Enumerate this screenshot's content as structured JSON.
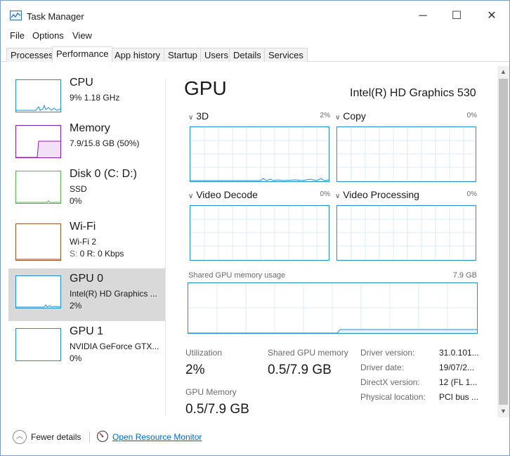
{
  "window": {
    "title": "Task Manager",
    "controls": {
      "minimize": "─",
      "maximize": "☐",
      "close": "✕"
    }
  },
  "menu": [
    "File",
    "Options",
    "View"
  ],
  "tabs": [
    "Processes",
    "Performance",
    "App history",
    "Startup",
    "Users",
    "Details",
    "Services"
  ],
  "active_tab": "Performance",
  "sidebar": {
    "items": [
      {
        "title": "CPU",
        "sub1": "9%  1.18 GHz",
        "sub2": "",
        "color": "#1f8fce"
      },
      {
        "title": "Memory",
        "sub1": "7.9/15.8 GB (50%)",
        "sub2": "",
        "color": "#8b19b3"
      },
      {
        "title": "Disk 0 (C: D:)",
        "sub1": "SSD",
        "sub2": "0%",
        "color": "#4db84d"
      },
      {
        "title": "Wi-Fi",
        "sub1": "Wi-Fi 2",
        "sub2_prefix": "S: ",
        "sub2": "0  R: 0 Kbps",
        "color": "#a0522d"
      },
      {
        "title": "GPU 0",
        "sub1": "Intel(R) HD Graphics ...",
        "sub2": "2%",
        "color": "#1f8fce"
      },
      {
        "title": "GPU 1",
        "sub1": "NVIDIA GeForce GTX...",
        "sub2": "0%",
        "color": "#1f8fce"
      }
    ],
    "selected": "GPU 0"
  },
  "main": {
    "title": "GPU",
    "device_name": "Intel(R) HD Graphics 530",
    "graphs": [
      {
        "label": "3D",
        "percent": "2%",
        "chevron": "∨"
      },
      {
        "label": "Copy",
        "percent": "0%",
        "chevron": "∨"
      },
      {
        "label": "Video Decode",
        "percent": "0%",
        "chevron": "∨"
      },
      {
        "label": "Video Processing",
        "percent": "0%",
        "chevron": "∨"
      }
    ],
    "shared_memory": {
      "label": "Shared GPU memory usage",
      "max": "7.9 GB"
    },
    "stats": {
      "utilization_label": "Utilization",
      "utilization_value": "2%",
      "shared_label": "Shared GPU memory",
      "shared_value": "0.5/7.9 GB",
      "gpu_memory_label": "GPU Memory",
      "gpu_memory_value": "0.5/7.9 GB"
    },
    "properties": [
      {
        "label": "Driver version:",
        "value": "31.0.101..."
      },
      {
        "label": "Driver date:",
        "value": "19/07/2..."
      },
      {
        "label": "DirectX version:",
        "value": "12 (FL 1..."
      },
      {
        "label": "Physical location:",
        "value": "PCI bus ..."
      }
    ]
  },
  "footer": {
    "fewer_details": "Fewer details",
    "resource_monitor": "Open Resource Monitor"
  },
  "colors": {
    "accent": "#1f8fce",
    "memory": "#8b19b3",
    "disk": "#4db84d",
    "wifi": "#a0522d",
    "selected_bg": "#d9d9d9",
    "link": "#0066cc"
  },
  "icons": [
    "task-manager-icon",
    "chevron-up-icon",
    "resource-monitor-icon",
    "chevron-down-icon"
  ]
}
